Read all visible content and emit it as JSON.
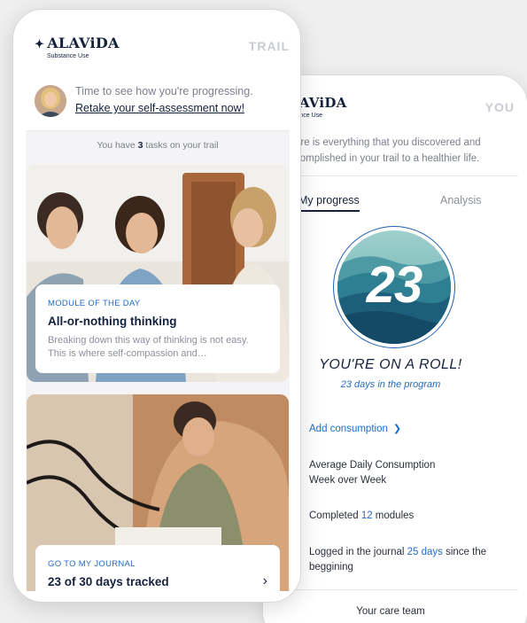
{
  "colors": {
    "brand_navy": "#14213d",
    "accent_blue": "#1f6cc7",
    "muted_gray": "#7a7f89"
  },
  "trail_screen": {
    "logo": {
      "mark": "✦",
      "name": "ALAViDA",
      "subtitle": "Substance Use"
    },
    "title": "TRAIL",
    "progress_prompt": "Time to see how you're progressing.",
    "retake_link": "Retake your self-assessment now!",
    "tasks": {
      "prefix": "You have ",
      "count": "3",
      "suffix": " tasks on your trail"
    },
    "module_card": {
      "label": "MODULE OF THE DAY",
      "title": "All-or-nothing thinking",
      "body": "Breaking down this way of thinking is not easy. This is where self-compassion and…"
    },
    "journal_card": {
      "label": "GO TO MY JOURNAL",
      "title": "23 of 30 days tracked",
      "chevron_icon": "chevron-right-icon"
    }
  },
  "you_screen": {
    "logo": {
      "name": "LAViDA",
      "subtitle": "stance Use"
    },
    "title": "YOU",
    "intro": "ere is everything that you discovered and complished in your trail to a healthier life.",
    "tabs": [
      {
        "label": "My progress",
        "active": true
      },
      {
        "label": "Analysis",
        "active": false
      }
    ],
    "badge_number": "23",
    "headline": "YOU'RE ON A ROLL!",
    "days_in_program": "23 days in the program",
    "add_consumption": "Add consumption",
    "stats": {
      "avg_line1": "Average Daily Consumption",
      "avg_line2": "Week over Week",
      "completed_prefix": "Completed ",
      "completed_count": "12",
      "completed_suffix": " modules",
      "logged_prefix": "Logged in the journal ",
      "logged_days": "25 days",
      "logged_suffix": " since the beggining"
    },
    "care_team": "Your care team"
  }
}
